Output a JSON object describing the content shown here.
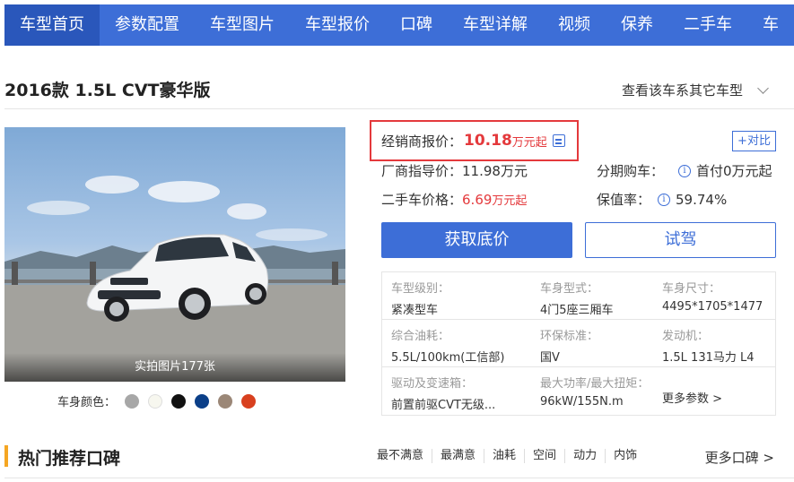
{
  "nav": {
    "items": [
      {
        "label": "车型首页",
        "active": true
      },
      {
        "label": "参数配置"
      },
      {
        "label": "车型图片"
      },
      {
        "label": "车型报价"
      },
      {
        "label": "口碑"
      },
      {
        "label": "车型详解"
      },
      {
        "label": "视频"
      },
      {
        "label": "保养"
      },
      {
        "label": "二手车"
      },
      {
        "label": "车"
      }
    ]
  },
  "header": {
    "model_title": "2016款 1.5L CVT豪华版",
    "series_link": "查看该车系其它车型",
    "series_icon": "chevron-down-icon"
  },
  "photo": {
    "caption": "实拍图片177张",
    "colors_label": "车身颜色：",
    "colors": [
      "#a7a7a7",
      "#f7f7ef",
      "#111111",
      "#0b3f88",
      "#9b8777",
      "#d8401f"
    ]
  },
  "price": {
    "dealer_label": "经销商报价：",
    "dealer_value": "10.18",
    "dealer_unit": "万元起",
    "dealer_icon": "calculator-icon",
    "compare_label": "+对比",
    "msrp_label": "厂商指导价：",
    "msrp_value": "11.98万元",
    "installment_label": "分期购车：",
    "installment_value": "首付0万元起",
    "used_label": "二手车价格：",
    "used_value": "6.69",
    "used_unit": "万元起",
    "retention_label": "保值率：",
    "retention_value": "59.74%",
    "info_icon_glyph": "i",
    "highlight_color": "#e4393c"
  },
  "actions": {
    "primary_label": "获取底价",
    "secondary_label": "试驾",
    "accent": "#3d6ed7"
  },
  "specs": {
    "rows": [
      [
        {
          "label": "车型级别：",
          "value": "紧凑型车"
        },
        {
          "label": "车身型式：",
          "value": "4门5座三厢车"
        },
        {
          "label": "车身尺寸：",
          "value": "4495*1705*1477"
        }
      ],
      [
        {
          "label": "综合油耗：",
          "value": "5.5L/100km(工信部)"
        },
        {
          "label": "环保标准：",
          "value": "国V"
        },
        {
          "label": "发动机：",
          "value": "1.5L 131马力 L4"
        }
      ],
      [
        {
          "label": "驱动及变速箱：",
          "value": "前置前驱CVT无级..."
        },
        {
          "label": "最大功率/最大扭矩：",
          "value": "96kW/155N.m"
        }
      ]
    ],
    "more_label": "更多参数 >"
  },
  "reviews": {
    "title": "热门推荐口碑",
    "tags": [
      "最不满意",
      "最满意",
      "油耗",
      "空间",
      "动力",
      "内饰"
    ],
    "more_label": "更多口碑 >"
  }
}
